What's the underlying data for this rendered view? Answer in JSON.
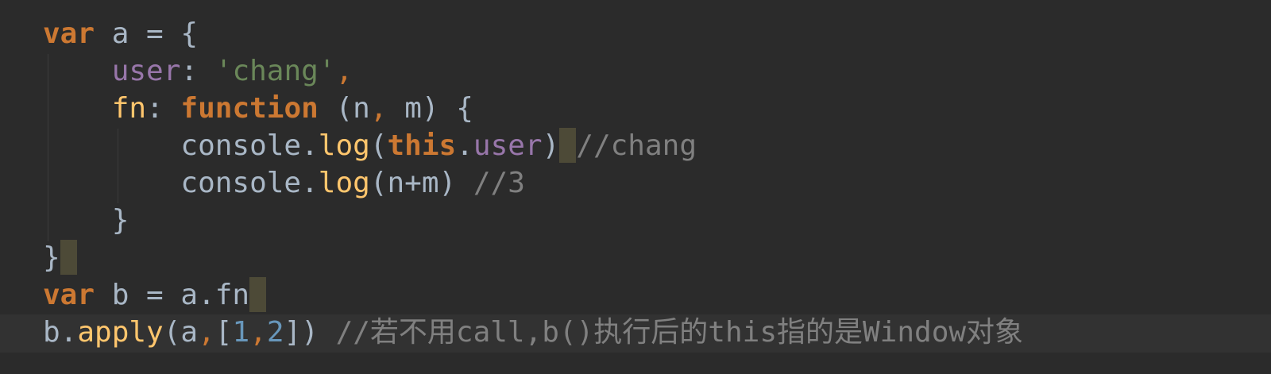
{
  "code": {
    "l1": {
      "kw": "var",
      "rest": " a = {"
    },
    "l2": {
      "prop": "user",
      "colon": ": ",
      "str": "'chang'",
      "comma": ","
    },
    "l3": {
      "name": "fn",
      "colon": ": ",
      "kw": "function",
      "rest": " (n",
      "comma": ",",
      "rest2": " m) {"
    },
    "l4": {
      "obj": "console.",
      "method": "log",
      "open": "(",
      "this": "this",
      "dot": ".",
      "prop": "user",
      "close": ")",
      "comment": "//chang"
    },
    "l5": {
      "obj": "console.",
      "method": "log",
      "args": "(n+m) ",
      "comment": "//3"
    },
    "l6": {
      "text": "}"
    },
    "l7": {
      "text": "}"
    },
    "l8": {
      "kw": "var",
      "rest": " b = a.fn"
    },
    "l9": {
      "obj": "b.",
      "method": "apply",
      "open": "(a",
      "comma1": ",",
      "bracket_open": "[",
      "num1": "1",
      "comma2": ",",
      "num2": "2",
      "close": "]) ",
      "comment": "//若不用call,b()执行后的this指的是Window对象"
    }
  },
  "colors": {
    "background": "#2b2b2b",
    "keyword": "#cc7832",
    "property": "#9876aa",
    "string": "#6a8759",
    "function": "#ffc66d",
    "number": "#6897bb",
    "comment": "#808080",
    "text": "#a9b7c6"
  }
}
